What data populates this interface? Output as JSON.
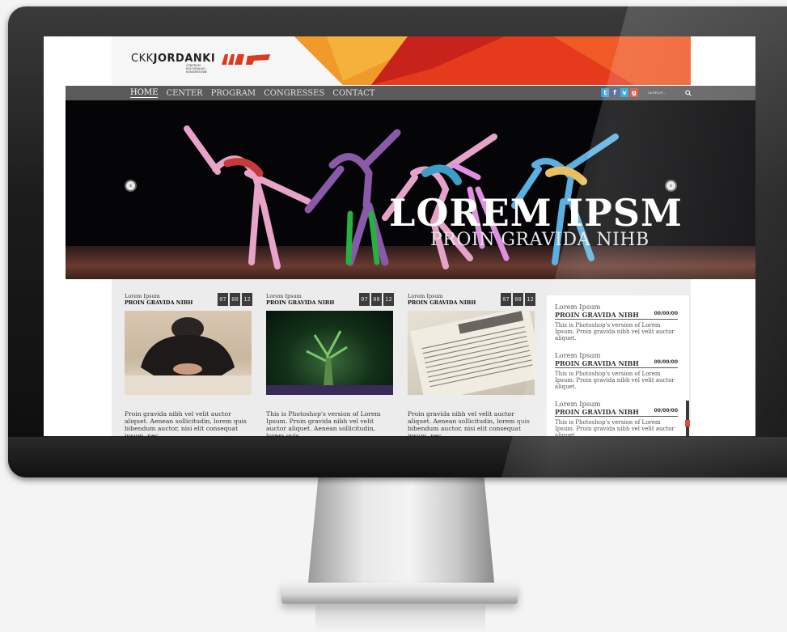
{
  "logo": {
    "prefix": "CKK",
    "name": "JORDANKI",
    "tagline": [
      "CENTRUM",
      "KULTURALNO",
      "KONGRESOWE"
    ]
  },
  "nav": {
    "items": [
      {
        "label": "HOME",
        "active": true
      },
      {
        "label": "CENTER",
        "active": false
      },
      {
        "label": "PROGRAM",
        "active": false
      },
      {
        "label": "CONGRESSES",
        "active": false
      },
      {
        "label": "CONTACT",
        "active": false
      }
    ]
  },
  "socials": [
    {
      "icon": "twitter-icon",
      "glyph": "t",
      "color": "#3aa0e0"
    },
    {
      "icon": "facebook-icon",
      "glyph": "f",
      "color": "#3b5998"
    },
    {
      "icon": "vimeo-icon",
      "glyph": "v",
      "color": "#1aa0d8"
    },
    {
      "icon": "google-plus-icon",
      "glyph": "g",
      "color": "#d9452f"
    }
  ],
  "search": {
    "placeholder": "SEARCH...",
    "icon": "search-icon"
  },
  "hero": {
    "title": "LOREM IPSM",
    "subtitle": "PROIN GRAVIDA NIHB",
    "prev_icon": "chevron-left-icon",
    "next_icon": "chevron-right-icon"
  },
  "cards": [
    {
      "kicker": "Lorem Ipsum",
      "title": "PROIN GRAVIDA NIBH",
      "date": [
        "07",
        "00",
        "12"
      ],
      "image": "businessman",
      "text": "Proin gravida nibh vel velit auctor aliquet. Aenean sollicitudin, lorem quis bibendum auctor, nisi elit consequat ipsum, nec"
    },
    {
      "kicker": "Lorem Ipsum",
      "title": "PROIN GRAVIDA NIBH",
      "date": [
        "07",
        "00",
        "12"
      ],
      "image": "forest-tree",
      "text": "This is Photoshop's version  of Lorem Ipsum. Proin gravida nibh vel velit auctor aliquet. Aenean sollicitudin, lorem quis"
    },
    {
      "kicker": "Lorem Ipsum",
      "title": "PROIN GRAVIDA NIBH",
      "date": [
        "07",
        "00",
        "12"
      ],
      "image": "newspaper",
      "text": "Proin gravida nibh vel velit auctor aliquet. Aenean sollicitudin, lorem quis bibendum auctor, nisi elit consequat ipsum, nec"
    }
  ],
  "sidebar": [
    {
      "kicker": "Lorem Ipsum",
      "title": "PROIN GRAVIDA NIBH",
      "date": "00/00/00",
      "text": "This is Photoshop's version  of Lorem Ipsum. Proin gravida nibh vel velit auctor aliquet."
    },
    {
      "kicker": "Lorem Ipsum",
      "title": "PROIN GRAVIDA NIBH",
      "date": "00/00/00",
      "text": "This is Photoshop's version  of Lorem Ipsum. Proin gravida nibh vel velit auctor aliquet."
    },
    {
      "kicker": "Lorem Ipsum",
      "title": "PROIN GRAVIDA NIBH",
      "date": "00/00/00",
      "text": "This is Photoshop's version  of Lorem Ipsum. Proin gravida nibh vel velit auctor aliquet."
    }
  ],
  "colors": {
    "accent": "#e03a1e",
    "nav_bg": "#5a5a5a",
    "hero_bg": "#050507"
  }
}
